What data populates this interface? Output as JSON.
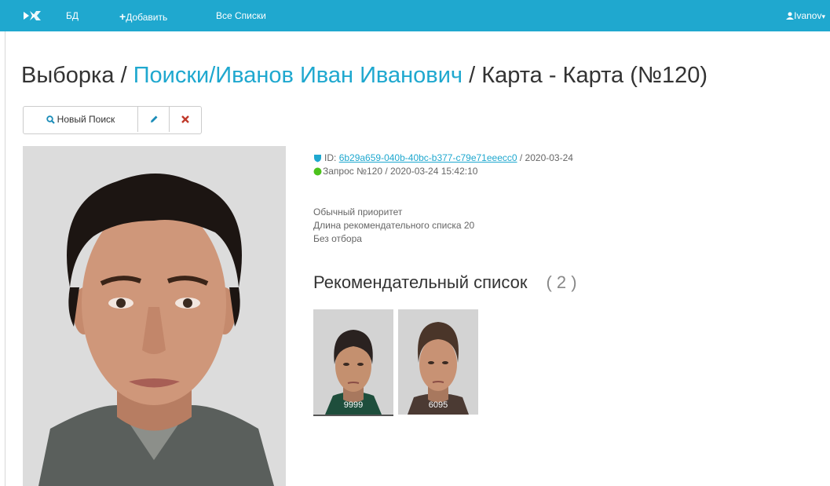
{
  "navbar": {
    "logo_icon": "logo-icon",
    "items": [
      {
        "label": "БД"
      },
      {
        "label": "Добавить",
        "prefix": "+"
      },
      {
        "label": "Все Списки"
      }
    ],
    "user_label": "Ivanov",
    "user_icon": "user-icon",
    "bg_color": "#1fa8cf"
  },
  "breadcrumb": {
    "part1": "Выборка /",
    "part2": "Поиски",
    "part3": "/Иванов Иван Иванович",
    "part4": "/ Карта - Карта (№120)"
  },
  "toolbar": {
    "new_search_label": "Новый Поиск",
    "search_icon": "search-icon",
    "edit_icon": "pencil-icon",
    "delete_icon": "close-icon"
  },
  "info": {
    "id_label": "ID:",
    "id_value": "6b29a659-040b-40bc-b377-c79e71eeecc0",
    "id_date": "/ 2020-03-24",
    "request_label": "Запрос №120 / 2020-03-24 15:42:10",
    "priority": "Обычный приоритет",
    "list_length": "Длина рекомендательного списка 20",
    "filter": "Без отбора"
  },
  "recommendations": {
    "title": "Рекомендательный список",
    "count": "( 2 )",
    "items": [
      {
        "number": "9999"
      },
      {
        "number": "6095"
      }
    ]
  }
}
